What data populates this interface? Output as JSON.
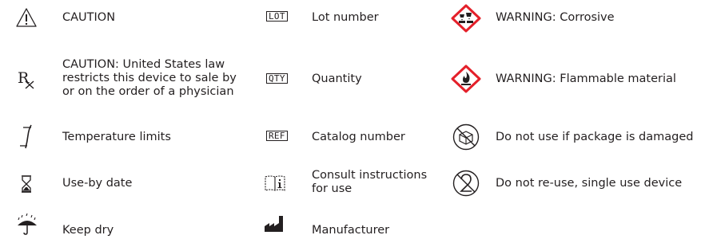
{
  "symbols": {
    "col1": [
      {
        "icon": "caution-triangle-icon",
        "label": "CAUTION"
      },
      {
        "icon": "rx-icon",
        "lines": [
          "CAUTION: United States law",
          "restricts this device to sale by",
          "or on the order of a physician"
        ]
      },
      {
        "icon": "thermometer-icon",
        "label": "Temperature limits"
      },
      {
        "icon": "hourglass-icon",
        "label": "Use-by date"
      },
      {
        "icon": "umbrella-icon",
        "label": "Keep dry"
      }
    ],
    "col2": [
      {
        "icon": "lot-box-icon",
        "box_text": "LOT",
        "label": "Lot number"
      },
      {
        "icon": "qty-box-icon",
        "box_text": "QTY",
        "label": "Quantity"
      },
      {
        "icon": "ref-box-icon",
        "box_text": "REF",
        "label": "Catalog number"
      },
      {
        "icon": "book-info-icon",
        "lines": [
          "Consult instructions",
          "for use"
        ]
      },
      {
        "icon": "factory-icon",
        "label": "Manufacturer"
      }
    ],
    "col3": [
      {
        "icon": "corrosive-diamond-icon",
        "label": "WARNING: Corrosive"
      },
      {
        "icon": "flame-diamond-icon",
        "label": "WARNING: Flammable material"
      },
      {
        "icon": "damaged-package-icon",
        "label": "Do not use if package is damaged"
      },
      {
        "icon": "no-reuse-icon",
        "label": "Do not re-use, single use device"
      }
    ]
  },
  "colors": {
    "text": "#231f20",
    "hazard_red": "#e4202a"
  }
}
